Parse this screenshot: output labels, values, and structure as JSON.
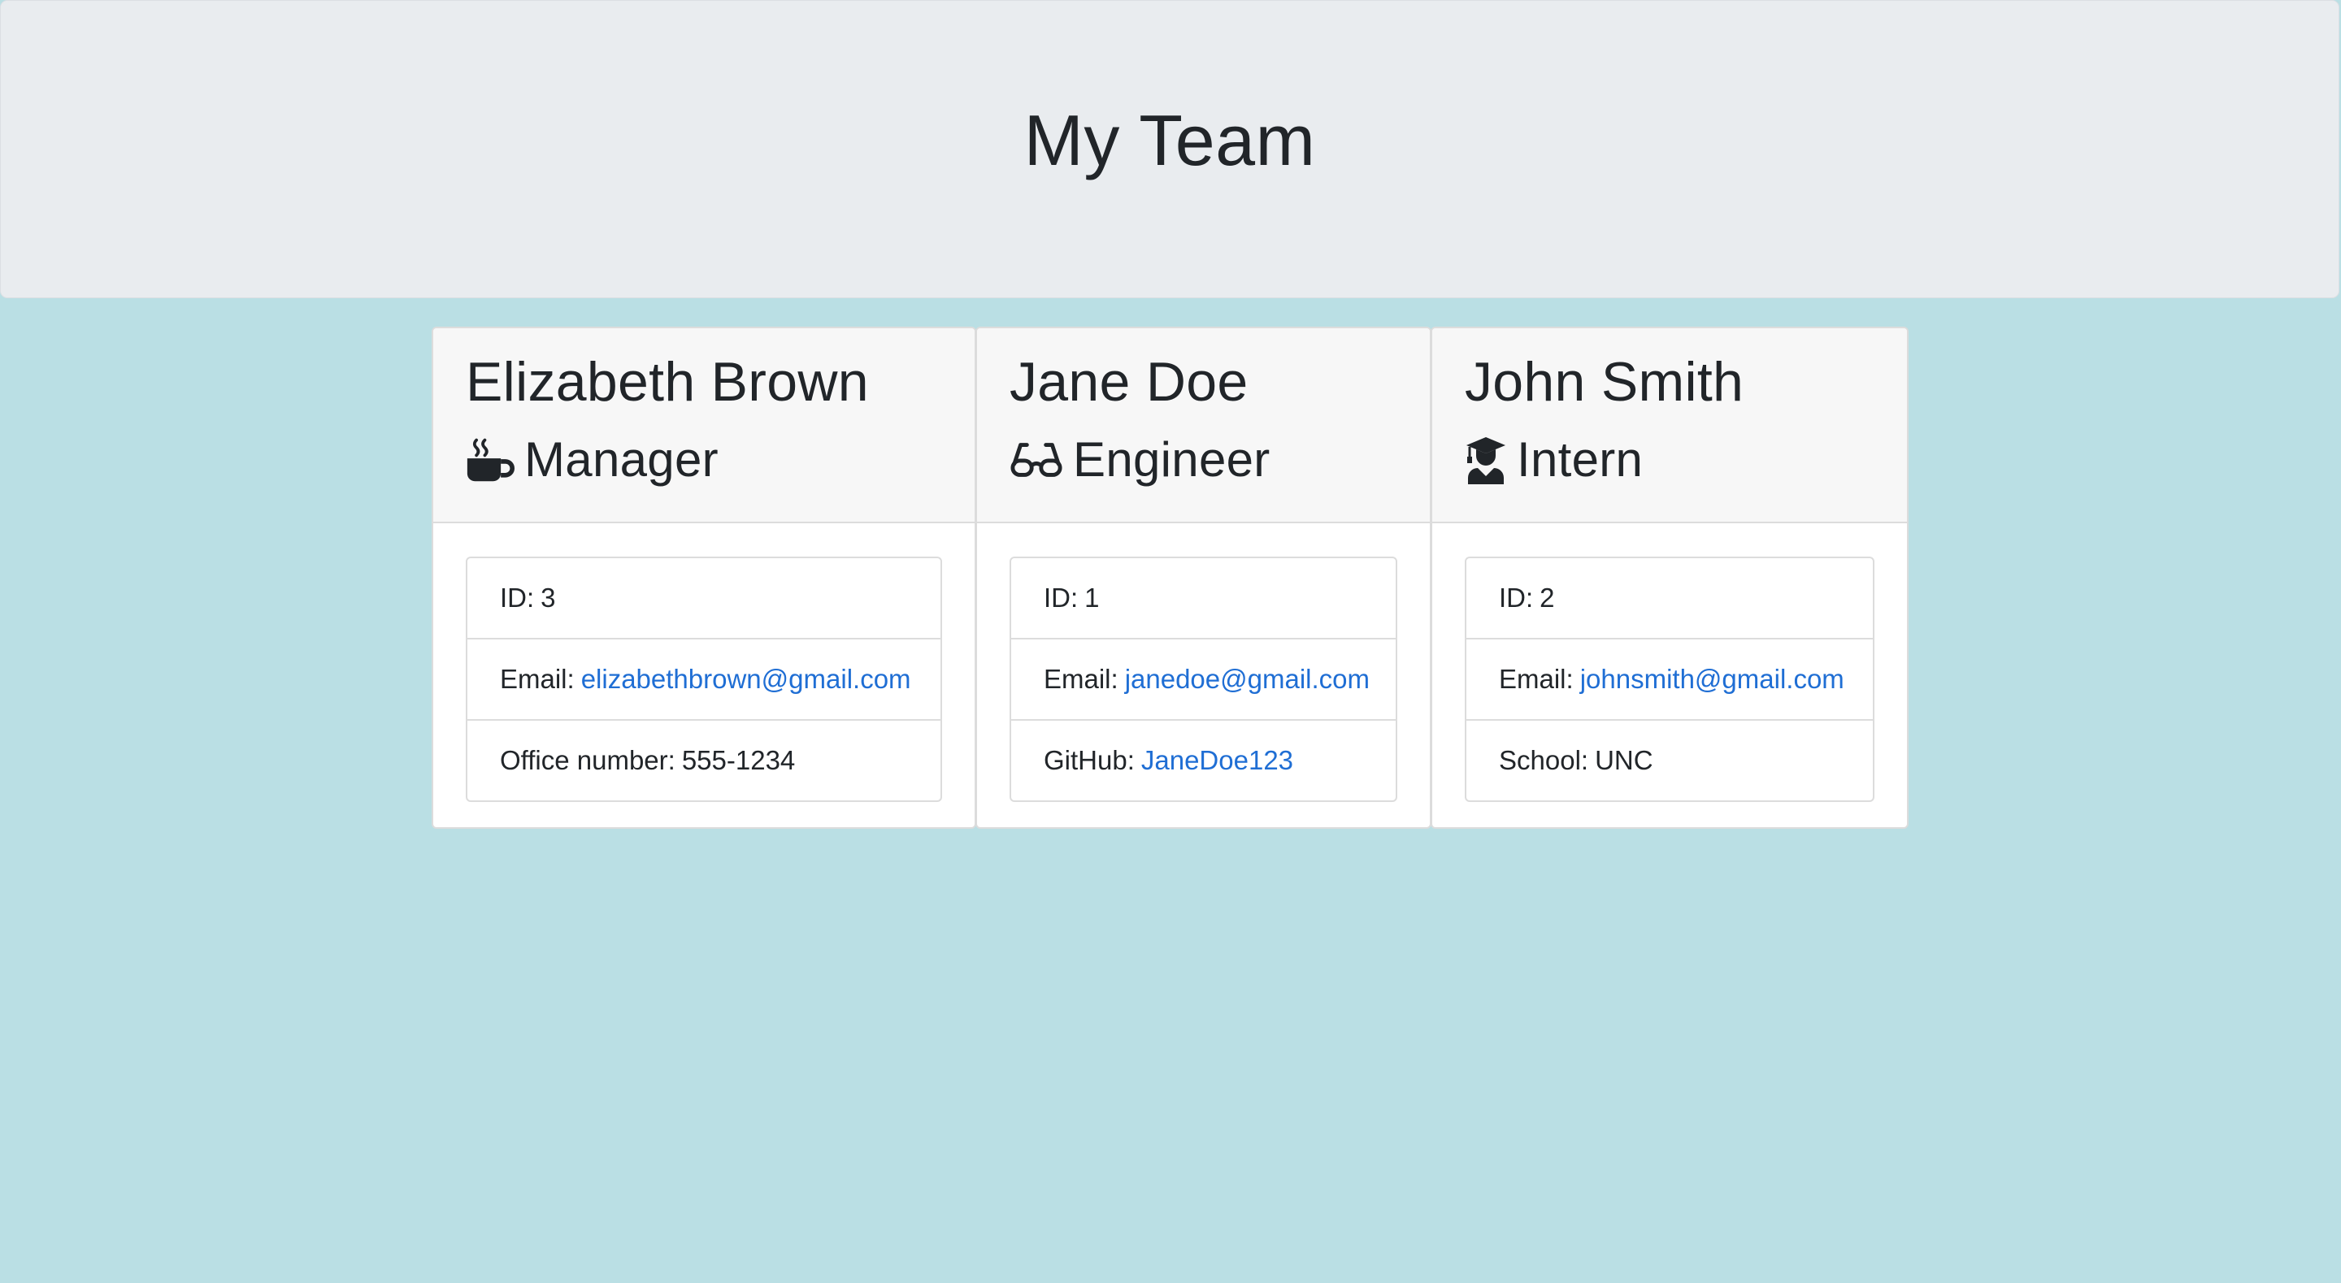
{
  "header": {
    "title": "My Team"
  },
  "cards": [
    {
      "name": "Elizabeth Brown",
      "role": "Manager",
      "role_icon": "coffee-mug-icon",
      "id_label": "ID:",
      "id_value": "3",
      "email_label": "Email:",
      "email": "elizabethbrown@gmail.com",
      "extra_label": "Office number:",
      "extra_value": "555-1234"
    },
    {
      "name": "Jane Doe",
      "role": "Engineer",
      "role_icon": "glasses-icon",
      "id_label": "ID:",
      "id_value": "1",
      "email_label": "Email:",
      "email": "janedoe@gmail.com",
      "extra_label": "GitHub:",
      "extra_value": "JaneDoe123"
    },
    {
      "name": "John Smith",
      "role": "Intern",
      "role_icon": "graduate-icon",
      "id_label": "ID:",
      "id_value": "2",
      "email_label": "Email:",
      "email": "johnsmith@gmail.com",
      "extra_label": "School:",
      "extra_value": "UNC"
    }
  ],
  "colors": {
    "background": "#badfe4",
    "header_bg": "#e9ecef",
    "link": "#1f6ed4",
    "text": "#212529"
  }
}
